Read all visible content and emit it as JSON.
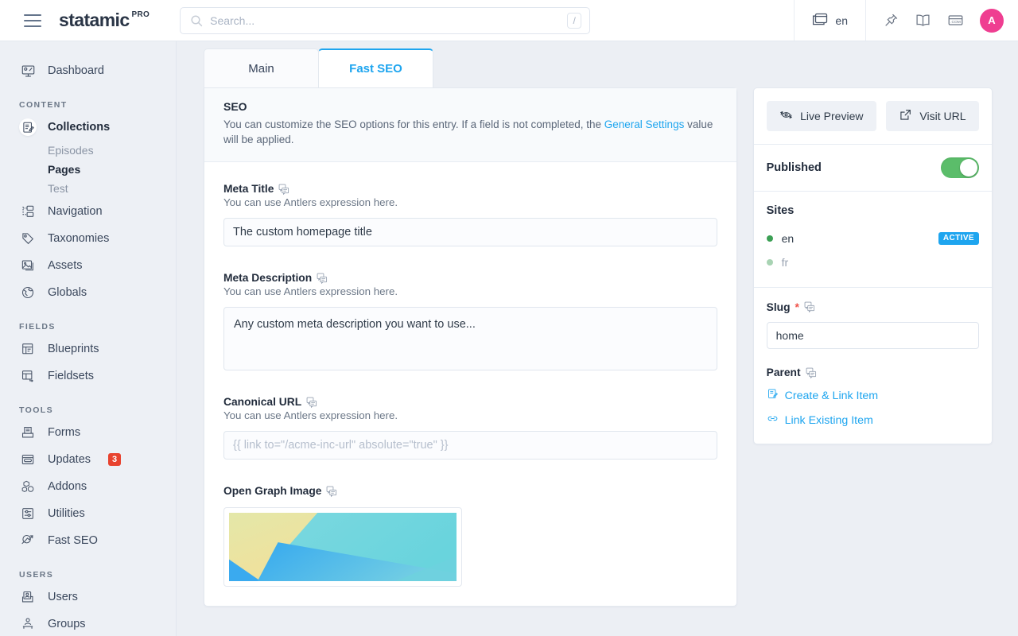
{
  "topbar": {
    "brand": "statamic",
    "brand_sup": "PRO",
    "search_placeholder": "Search...",
    "search_value": "",
    "slash_hint": "/",
    "site_label": "en",
    "avatar_initial": "A",
    "icons": [
      "window-icon",
      "pin-icon",
      "book-icon",
      "dotcom-icon"
    ]
  },
  "sidebar": {
    "dashboard": "Dashboard",
    "sections": [
      {
        "title": "CONTENT",
        "items": [
          {
            "label": "Collections",
            "icon": "collections-icon",
            "active": true,
            "children": [
              {
                "label": "Episodes",
                "active": false
              },
              {
                "label": "Pages",
                "active": true
              },
              {
                "label": "Test",
                "active": false
              }
            ]
          },
          {
            "label": "Navigation",
            "icon": "navigation-icon"
          },
          {
            "label": "Taxonomies",
            "icon": "tag-icon"
          },
          {
            "label": "Assets",
            "icon": "image-icon"
          },
          {
            "label": "Globals",
            "icon": "globe-icon"
          }
        ]
      },
      {
        "title": "FIELDS",
        "items": [
          {
            "label": "Blueprints",
            "icon": "blueprint-icon"
          },
          {
            "label": "Fieldsets",
            "icon": "fieldset-icon"
          }
        ]
      },
      {
        "title": "TOOLS",
        "items": [
          {
            "label": "Forms",
            "icon": "forms-icon"
          },
          {
            "label": "Updates",
            "icon": "updates-icon",
            "badge": "3"
          },
          {
            "label": "Addons",
            "icon": "addons-icon"
          },
          {
            "label": "Utilities",
            "icon": "utilities-icon"
          },
          {
            "label": "Fast SEO",
            "icon": "seo-magnifier-icon"
          }
        ]
      },
      {
        "title": "USERS",
        "items": [
          {
            "label": "Users",
            "icon": "users-icon"
          },
          {
            "label": "Groups",
            "icon": "groups-icon"
          }
        ]
      }
    ]
  },
  "tabs": [
    {
      "label": "Main",
      "active": false
    },
    {
      "label": "Fast SEO",
      "active": true
    }
  ],
  "seo_section": {
    "heading": "SEO",
    "description_before": "You can customize the SEO options for this entry. If a field is not completed, the ",
    "description_link": "General Settings",
    "description_after": " value will be applied."
  },
  "fields": {
    "meta_title": {
      "label": "Meta Title",
      "instructions": "You can use Antlers expression here.",
      "value": "The custom homepage title",
      "placeholder": ""
    },
    "meta_description": {
      "label": "Meta Description",
      "instructions": "You can use Antlers expression here.",
      "value": "Any custom meta description you want to use...",
      "placeholder": ""
    },
    "canonical_url": {
      "label": "Canonical URL",
      "instructions": "You can use Antlers expression here.",
      "value": "",
      "placeholder": "{{ link to=\"/acme-inc-url\" absolute=\"true\" }}"
    },
    "open_graph_image": {
      "label": "Open Graph Image"
    }
  },
  "panel": {
    "live_preview": "Live Preview",
    "visit_url": "Visit URL",
    "published_label": "Published",
    "published_on": true,
    "sites_label": "Sites",
    "sites": [
      {
        "label": "en",
        "badge": "ACTIVE",
        "active": true
      },
      {
        "label": "fr",
        "badge": "",
        "active": false
      }
    ],
    "slug_label": "Slug",
    "slug_required": "*",
    "slug_value": "home",
    "parent_label": "Parent",
    "create_link_item": "Create & Link Item",
    "link_existing_item": "Link Existing Item"
  },
  "colors": {
    "accent_blue": "#1ea5ef",
    "toggle_green": "#5bbd6a",
    "avatar_pink": "#ef3e91",
    "badge_red": "#e8432f",
    "sidebar_bg": "#edf0f5"
  }
}
